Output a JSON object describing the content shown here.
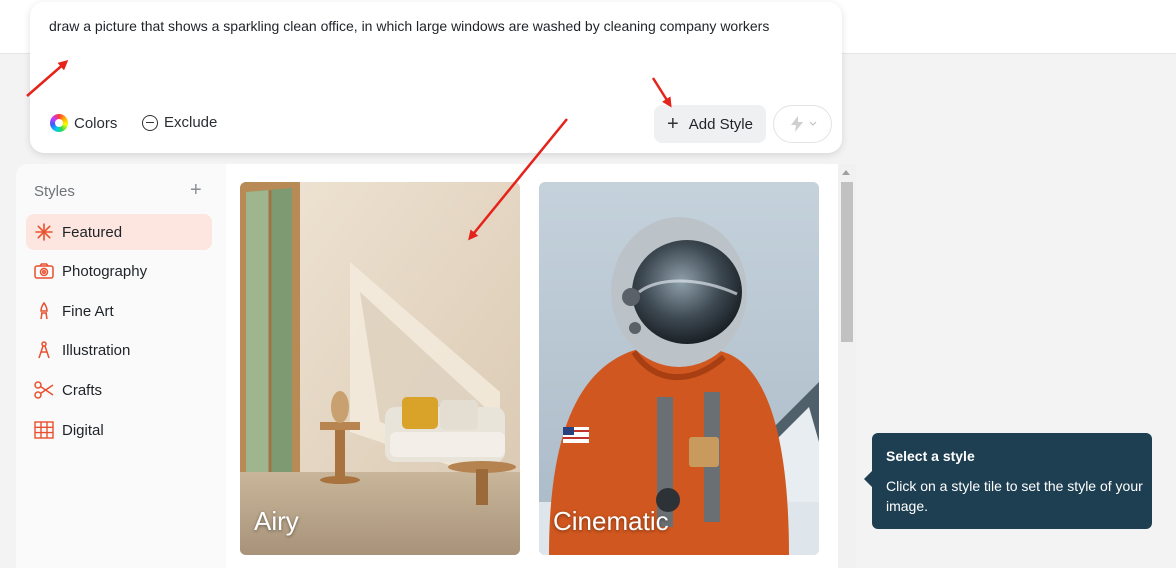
{
  "prompt": {
    "text": "draw a picture that shows a sparkling clean office, in which large windows are washed by cleaning company workers",
    "colors_label": "Colors",
    "exclude_label": "Exclude",
    "add_style_label": "Add Style"
  },
  "sidebar": {
    "header": "Styles",
    "items": [
      {
        "label": "Featured",
        "icon": "asterisk-icon",
        "active": true
      },
      {
        "label": "Photography",
        "icon": "camera-icon",
        "active": false
      },
      {
        "label": "Fine Art",
        "icon": "brush-icon",
        "active": false
      },
      {
        "label": "Illustration",
        "icon": "compass-pen-icon",
        "active": false
      },
      {
        "label": "Crafts",
        "icon": "scissors-icon",
        "active": false
      },
      {
        "label": "Digital",
        "icon": "grid-icon",
        "active": false
      }
    ]
  },
  "tiles": [
    {
      "label": "Airy"
    },
    {
      "label": "Cinematic"
    }
  ],
  "tooltip": {
    "title": "Select a style",
    "body": "Click on a style tile to set the style of your image."
  },
  "colors": {
    "accent": "#e8502f",
    "active_bg": "#fde6e0",
    "tooltip_bg": "#1e3f52",
    "annotation_arrow": "#e5231b"
  }
}
